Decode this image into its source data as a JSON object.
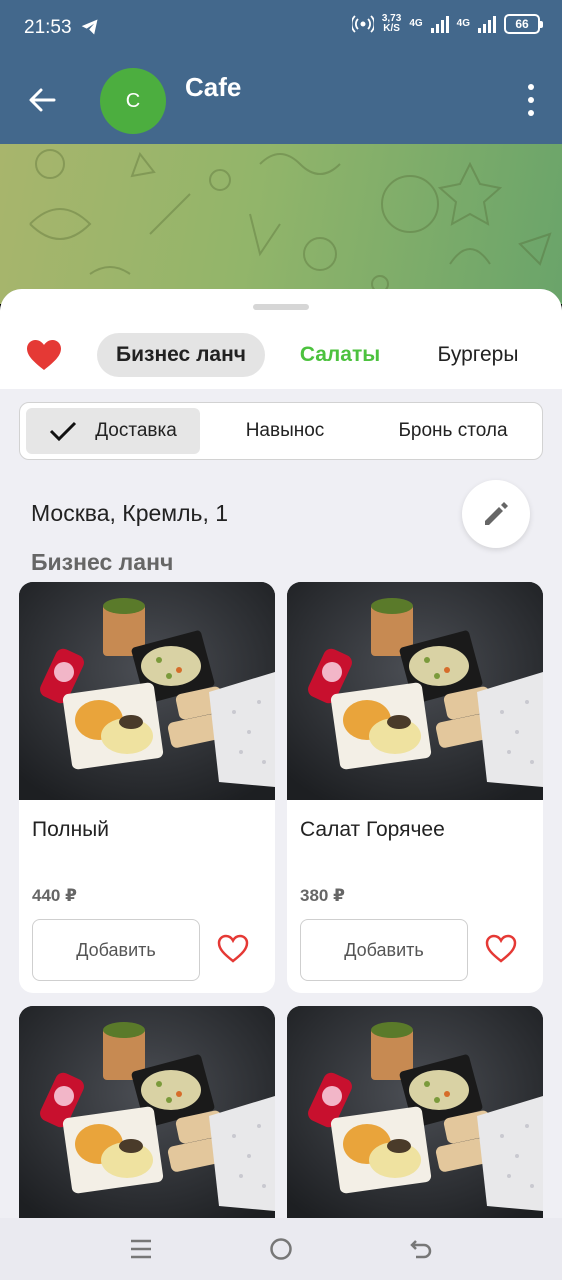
{
  "status": {
    "time": "21:53",
    "speed_value": "3,73",
    "speed_unit": "K/S",
    "net1": "4G",
    "net2": "4G",
    "battery": "66"
  },
  "header": {
    "avatar_letter": "C",
    "title": "Cafe"
  },
  "categories": [
    {
      "label": "Бизнес ланч"
    },
    {
      "label": "Салаты"
    },
    {
      "label": "Бургеры"
    }
  ],
  "delivery_options": [
    {
      "label": "Доставка"
    },
    {
      "label": "Навынос"
    },
    {
      "label": "Бронь стола"
    }
  ],
  "address": "Москва, Кремль, 1",
  "section_title": "Бизнес ланч",
  "products": [
    {
      "name": "Полный",
      "price": "440 ₽",
      "add_label": "Добавить"
    },
    {
      "name": "Салат Горячее",
      "price": "380 ₽",
      "add_label": "Добавить"
    },
    {
      "name": "",
      "price": "",
      "add_label": ""
    },
    {
      "name": "",
      "price": "",
      "add_label": ""
    }
  ],
  "colors": {
    "header_bg": "#43688c",
    "accent_green": "#4cc23e",
    "heart_red": "#e53935"
  }
}
